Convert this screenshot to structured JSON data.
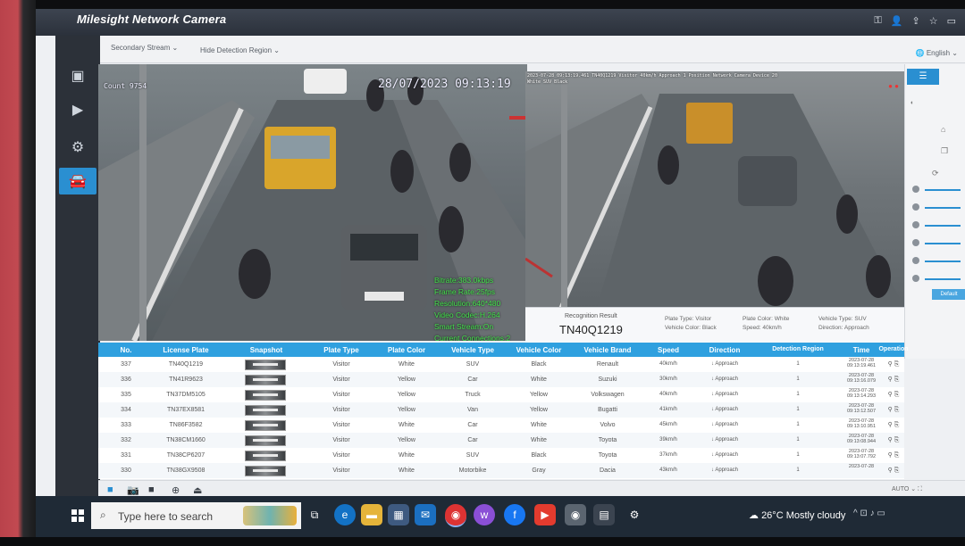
{
  "app": {
    "title": "Milesight Network Camera",
    "language": "English"
  },
  "top_bar": {
    "stream_select": "Secondary Stream",
    "region_select": "Hide Detection Region"
  },
  "left_camera": {
    "timestamp": "28/07/2023 09:13:19",
    "osd_line": "Count 9754",
    "overlay_stats": [
      "Bitrate:383.0kbps",
      "Frame Rate:25fps",
      "Resolution:640*480",
      "Video Codec:H.264",
      "Smart Stream:On",
      "Current Connections:2"
    ]
  },
  "right_camera": {
    "osd_line1": "2023-07-28 09:13:19.461 TN40Q1219 Visitor 40km/h Approach 1 Position Network Camera Device 20",
    "osd_line2": "White SUV Black"
  },
  "recognition": {
    "label": "Recognition Result",
    "plate": "TN40Q1219",
    "plate_type": "Plate Type: Visitor",
    "vehicle_color": "Vehicle Color: Black",
    "plate_color": "Plate Color: White",
    "speed": "Speed: 40km/h",
    "vehicle_type": "Vehicle Type: SUV",
    "direction": "Direction: Approach"
  },
  "side_panel": {
    "button": "Default"
  },
  "table": {
    "columns": [
      "No.",
      "License Plate",
      "Snapshot",
      "Plate Type",
      "Plate Color",
      "Vehicle Type",
      "Vehicle Color",
      "Vehicle Brand",
      "Speed",
      "Direction",
      "Detection Region",
      "Time",
      "Operation"
    ],
    "rows": [
      {
        "no": "337",
        "plate": "TN40Q1219",
        "ptype": "Visitor",
        "pcolor": "White",
        "vtype": "SUV",
        "vcolor": "Black",
        "brand": "Renault",
        "speed": "40km/h",
        "dir": "↓ Approach",
        "region": "1",
        "date": "2023-07-28",
        "time": "09:13:19.461"
      },
      {
        "no": "336",
        "plate": "TN41R9623",
        "ptype": "Visitor",
        "pcolor": "Yellow",
        "vtype": "Car",
        "vcolor": "White",
        "brand": "Suzuki",
        "speed": "30km/h",
        "dir": "↓ Approach",
        "region": "1",
        "date": "2023-07-28",
        "time": "09:13:16.079"
      },
      {
        "no": "335",
        "plate": "TN37DM5105",
        "ptype": "Visitor",
        "pcolor": "Yellow",
        "vtype": "Truck",
        "vcolor": "Yellow",
        "brand": "Volkswagen",
        "speed": "40km/h",
        "dir": "↓ Approach",
        "region": "1",
        "date": "2023-07-28",
        "time": "09:13:14.293"
      },
      {
        "no": "334",
        "plate": "TN37EX8581",
        "ptype": "Visitor",
        "pcolor": "Yellow",
        "vtype": "Van",
        "vcolor": "Yellow",
        "brand": "Bugatti",
        "speed": "41km/h",
        "dir": "↓ Approach",
        "region": "1",
        "date": "2023-07-28",
        "time": "09:13:12.507"
      },
      {
        "no": "333",
        "plate": "TN86F3582",
        "ptype": "Visitor",
        "pcolor": "White",
        "vtype": "Car",
        "vcolor": "White",
        "brand": "Volvo",
        "speed": "45km/h",
        "dir": "↓ Approach",
        "region": "1",
        "date": "2023-07-28",
        "time": "09:13:10.951"
      },
      {
        "no": "332",
        "plate": "TN38CM1660",
        "ptype": "Visitor",
        "pcolor": "Yellow",
        "vtype": "Car",
        "vcolor": "White",
        "brand": "Toyota",
        "speed": "39km/h",
        "dir": "↓ Approach",
        "region": "1",
        "date": "2023-07-28",
        "time": "09:13:08.944"
      },
      {
        "no": "331",
        "plate": "TN38CP6207",
        "ptype": "Visitor",
        "pcolor": "White",
        "vtype": "SUV",
        "vcolor": "Black",
        "brand": "Toyota",
        "speed": "37km/h",
        "dir": "↓ Approach",
        "region": "1",
        "date": "2023-07-28",
        "time": "09:13:07.792"
      },
      {
        "no": "330",
        "plate": "TN38GX9508",
        "ptype": "Visitor",
        "pcolor": "White",
        "vtype": "Motorbike",
        "vcolor": "Gray",
        "brand": "Dacia",
        "speed": "43km/h",
        "dir": "↓ Approach",
        "region": "1",
        "date": "2023-07-28",
        "time": ""
      }
    ]
  },
  "bottom_toolbar": {
    "mode": "AUTO"
  },
  "taskbar": {
    "search_placeholder": "Type here to search",
    "weather": "26°C  Mostly cloudy"
  }
}
